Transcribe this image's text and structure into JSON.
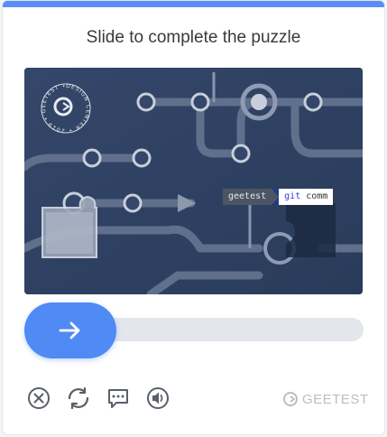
{
  "captcha": {
    "title": "Slide to complete the puzzle",
    "logo_ring_text": "DESIGN CENTER ∙ 2019 ∙ GEETEST ∙",
    "command_prompt": "geetest",
    "command_text": "git",
    "command_tail": "comm",
    "slider_progress": 0,
    "accent_color": "#4f8af5",
    "topbar_color": "#5b8df6"
  },
  "icons": {
    "close": "close-icon",
    "refresh": "refresh-icon",
    "feedback": "feedback-icon",
    "audio": "audio-icon",
    "arrow": "arrow-right-icon"
  },
  "brand": {
    "name": "GEETEST"
  }
}
